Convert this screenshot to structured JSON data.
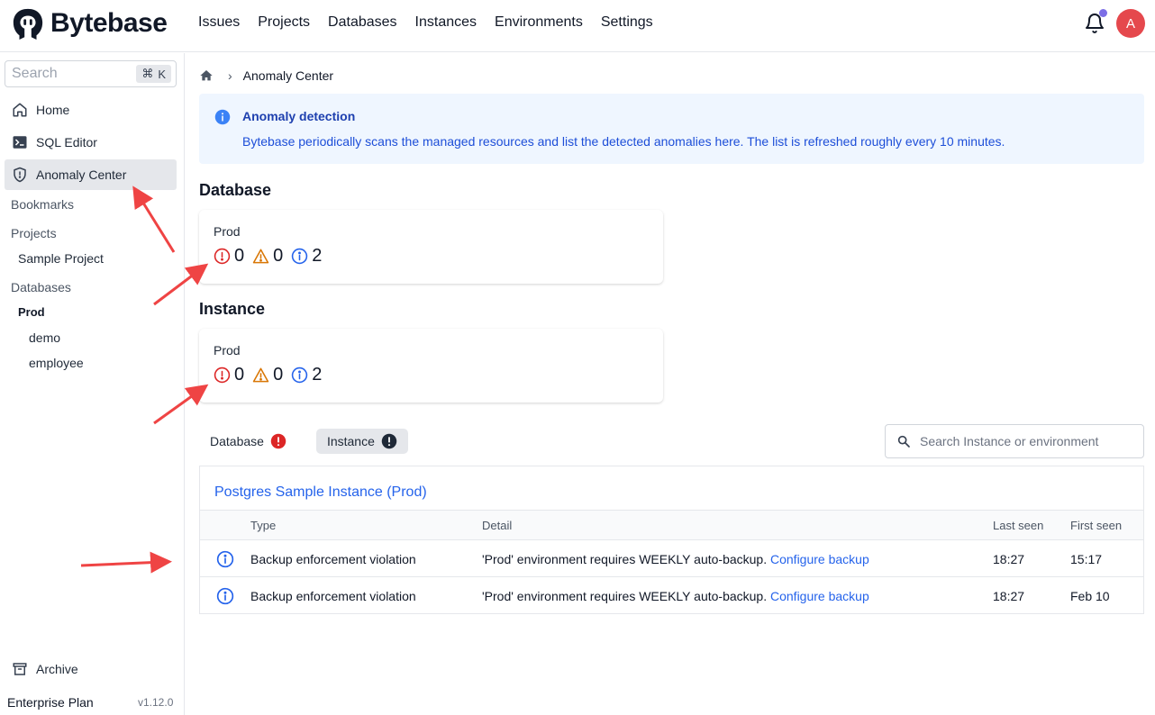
{
  "brand": {
    "name": "Bytebase"
  },
  "nav": [
    "Issues",
    "Projects",
    "Databases",
    "Instances",
    "Environments",
    "Settings"
  ],
  "user": {
    "avatar_initial": "A"
  },
  "colors": {
    "error": "#dc2626",
    "warning": "#d97706",
    "info": "#2563eb",
    "annotation": "#ef4444"
  },
  "sidebar": {
    "search_placeholder": "Search",
    "search_shortcut_symbol": "⌘",
    "search_shortcut_key": "K",
    "items": [
      {
        "label": "Home",
        "icon": "home-icon"
      },
      {
        "label": "SQL Editor",
        "icon": "terminal-icon"
      },
      {
        "label": "Anomaly Center",
        "icon": "shield-icon"
      }
    ],
    "bookmarks_label": "Bookmarks",
    "projects_label": "Projects",
    "project_items": [
      "Sample Project"
    ],
    "databases_label": "Databases",
    "db_env": "Prod",
    "db_items": [
      "demo",
      "employee"
    ],
    "archive_label": "Archive",
    "plan": "Enterprise Plan",
    "version": "v1.12.0"
  },
  "breadcrumb": {
    "current": "Anomaly Center"
  },
  "alert": {
    "title": "Anomaly detection",
    "description": "Bytebase periodically scans the managed resources and list the detected anomalies here. The list is refreshed roughly every 10 minutes."
  },
  "database_section": {
    "title": "Database",
    "env": "Prod",
    "error": "0",
    "warning": "0",
    "info": "2"
  },
  "instance_section": {
    "title": "Instance",
    "env": "Prod",
    "error": "0",
    "warning": "0",
    "info": "2"
  },
  "tabs": [
    {
      "label": "Database"
    },
    {
      "label": "Instance"
    }
  ],
  "table_search_placeholder": "Search Instance or environment",
  "panel": {
    "title": "Postgres Sample Instance (Prod)",
    "columns": [
      "Type",
      "Detail",
      "Last seen",
      "First seen"
    ],
    "rows": [
      {
        "type": "Backup enforcement violation",
        "detail": "'Prod' environment requires WEEKLY auto-backup.",
        "link": "Configure backup",
        "last_seen": "18:27",
        "first_seen": "15:17"
      },
      {
        "type": "Backup enforcement violation",
        "detail": "'Prod' environment requires WEEKLY auto-backup.",
        "link": "Configure backup",
        "last_seen": "18:27",
        "first_seen": "Feb 10"
      }
    ]
  }
}
